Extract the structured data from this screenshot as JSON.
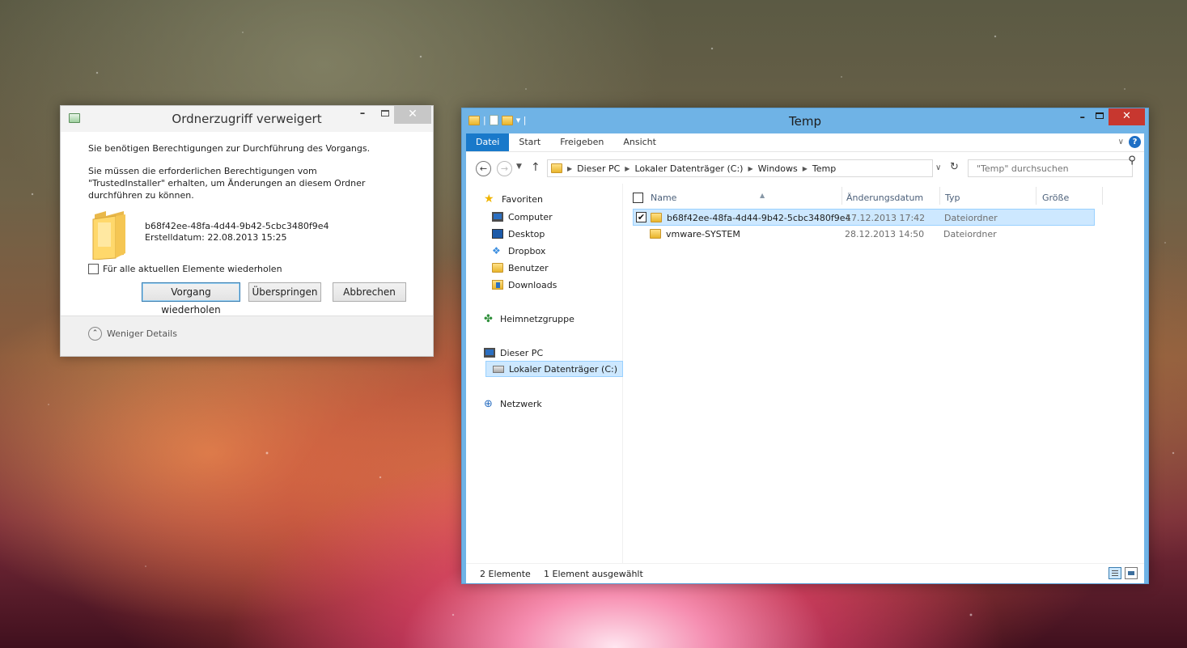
{
  "dialog": {
    "title": "Ordnerzugriff verweigert",
    "min_label": "–",
    "close_label": "✕",
    "line1": "Sie benötigen Berechtigungen zur Durchführung des Vorgangs.",
    "line2": "Sie müssen die erforderlichen Berechtigungen vom \"TrustedInstaller\" erhalten, um Änderungen an diesem Ordner durchführen zu können.",
    "folder_name": "b68f42ee-48fa-4d44-9b42-5cbc3480f9e4",
    "created": "Erstelldatum: 22.08.2013 15:25",
    "checkbox_label": "Für alle aktuellen Elemente wiederholen",
    "btn_retry": "Vorgang wiederholen",
    "btn_skip": "Überspringen",
    "btn_cancel": "Abbrechen",
    "details_toggle": "Weniger Details"
  },
  "explorer": {
    "title": "Temp",
    "min_label": "–",
    "close_label": "✕",
    "qat_sep": "| ",
    "qat_dd": "▾ |",
    "ribbon_tabs": [
      "Datei",
      "Start",
      "Freigeben",
      "Ansicht"
    ],
    "address": {
      "crumbs": [
        "Dieser PC",
        "Lokaler Datenträger (C:)",
        "Windows",
        "Temp"
      ]
    },
    "search_placeholder": "\"Temp\" durchsuchen",
    "nav_pane": {
      "favorites_label": "Favoriten",
      "favorites": [
        "Computer",
        "Desktop",
        "Dropbox",
        "Benutzer",
        "Downloads"
      ],
      "homegroup": "Heimnetzgruppe",
      "this_pc": "Dieser PC",
      "local_disk": "Lokaler Datenträger (C:)",
      "network": "Netzwerk"
    },
    "columns": {
      "name": "Name",
      "date": "Änderungsdatum",
      "type": "Typ",
      "size": "Größe"
    },
    "files": [
      {
        "name": "b68f42ee-48fa-4d44-9b42-5cbc3480f9e4",
        "date": "17.12.2013 17:42",
        "type": "Dateiordner",
        "size": ""
      },
      {
        "name": "vmware-SYSTEM",
        "date": "28.12.2013 14:50",
        "type": "Dateiordner",
        "size": ""
      }
    ],
    "status": {
      "count": "2 Elemente",
      "selected": "1 Element ausgewählt"
    }
  }
}
